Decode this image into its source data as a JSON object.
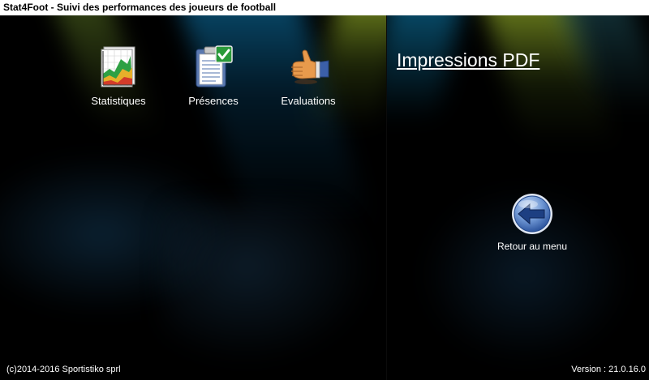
{
  "window": {
    "title": "Stat4Foot - Suivi des performances des joueurs de football"
  },
  "menu": {
    "items": [
      {
        "label": "Statistiques",
        "icon": "statistics-chart-icon"
      },
      {
        "label": "Présences",
        "icon": "attendance-clipboard-icon"
      },
      {
        "label": "Evaluations",
        "icon": "thumbs-up-icon"
      }
    ]
  },
  "pdf": {
    "title": "Impressions PDF",
    "back_label": "Retour au menu",
    "back_icon": "back-arrow-icon"
  },
  "footer": {
    "copyright": "(c)2014-2016 Sportistiko sprl",
    "version": "Version : 21.0.16.0"
  },
  "colors": {
    "background": "#000000",
    "text": "#ffffff",
    "titlebar_bg": "#ffffff",
    "back_button": "#4a72b8"
  }
}
